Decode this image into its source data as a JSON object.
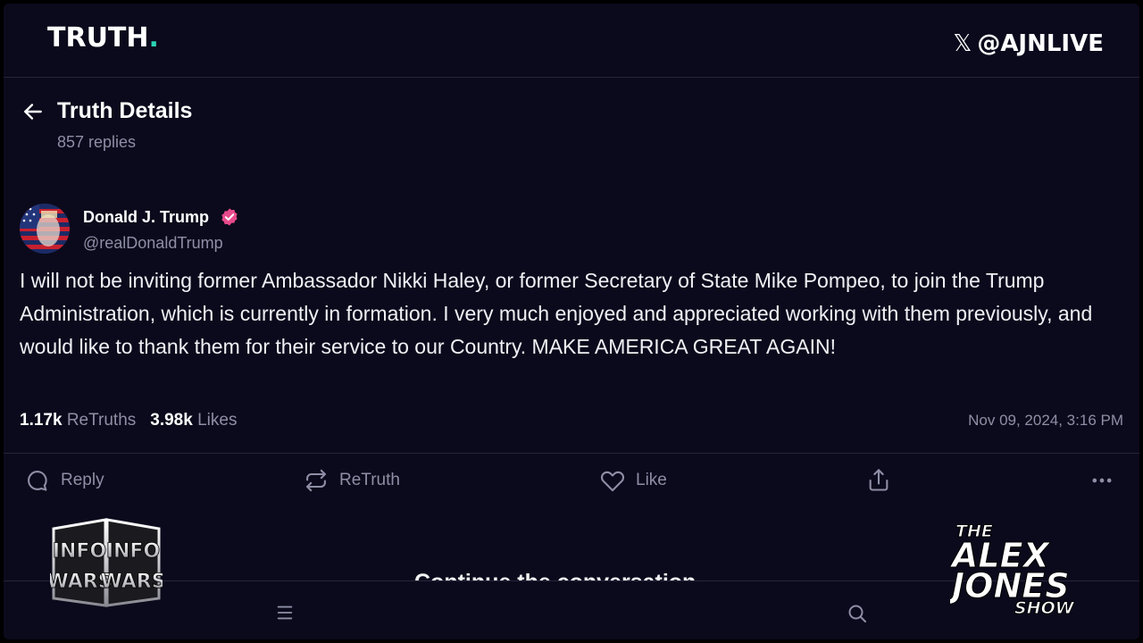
{
  "app": {
    "logo_text": "TRUTH",
    "logo_dot": ".",
    "accent_color": "#2bd4b6",
    "background_color": "#0b0a1c"
  },
  "overlay": {
    "x_handle": "@AJNLIVE",
    "infowars_logo": "INFOWARS",
    "show_logo": [
      "THE",
      "ALEX",
      "JONES",
      "SHOW"
    ]
  },
  "header": {
    "title": "Truth Details",
    "replies": "857 replies"
  },
  "post": {
    "author_name": "Donald J. Trump",
    "author_handle": "@realDonaldTrump",
    "verified_color": "#e74a8c",
    "body": "I will not be inviting former Ambassador Nikki Haley, or former Secretary of State Mike Pompeo, to join the Trump Administration, which is currently in formation. I very much enjoyed and appreciated working with them previously, and would like to thank them for their service to our Country. MAKE AMERICA GREAT AGAIN!",
    "retruths_count": "1.17k",
    "retruths_label": "ReTruths",
    "likes_count": "3.98k",
    "likes_label": "Likes",
    "timestamp": "Nov 09, 2024, 3:16 PM"
  },
  "actions": {
    "reply": "Reply",
    "retruth": "ReTruth",
    "like": "Like"
  },
  "continue_text": "Continue the conversation"
}
